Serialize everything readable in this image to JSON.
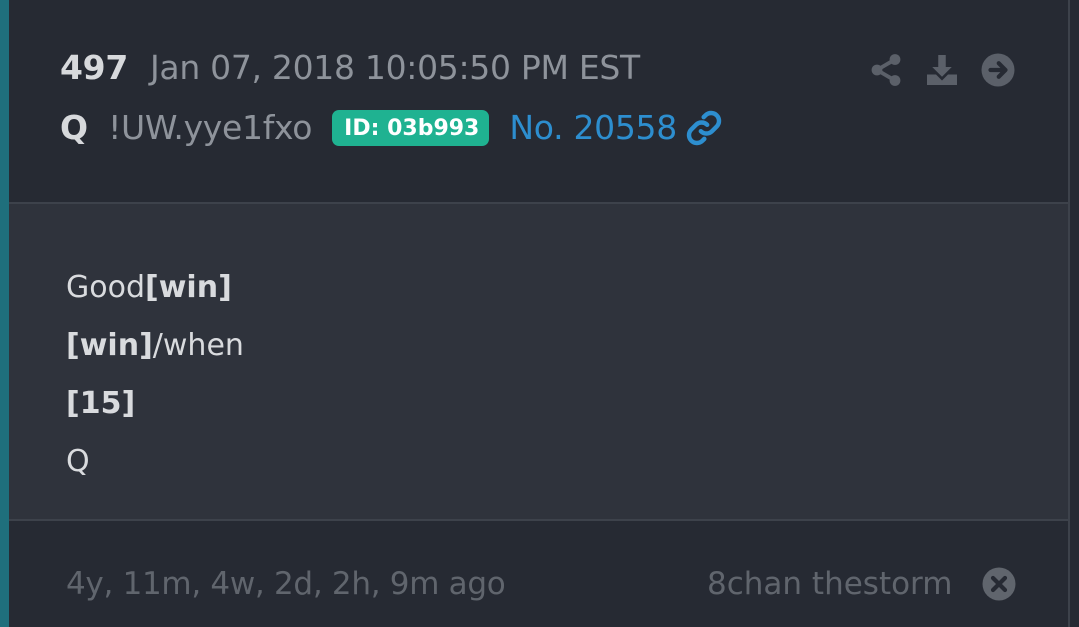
{
  "post": {
    "number": "497",
    "datetime": "Jan 07, 2018 10:05:50 PM EST",
    "author": "Q",
    "tripcode": "!UW.yye1fxo",
    "id_badge": "ID: 03b993",
    "post_no": "No. 20558",
    "badge_color": "#1fb291",
    "link_color": "#2d8ecf"
  },
  "actions": [
    {
      "icon": "share-icon"
    },
    {
      "icon": "download-icon"
    },
    {
      "icon": "arrow-circle-right-icon"
    }
  ],
  "message": {
    "l1_plain": "Good",
    "l1_bold": "[win]",
    "l2_bold": "[win]",
    "l2_plain": "/when",
    "l3_bold": "[15]",
    "l4_plain": "Q"
  },
  "footer": {
    "ago": "4y, 11m, 4w, 2d, 2h, 9m ago",
    "source": "8chan thestorm",
    "close_icon": "close-circle-icon"
  }
}
